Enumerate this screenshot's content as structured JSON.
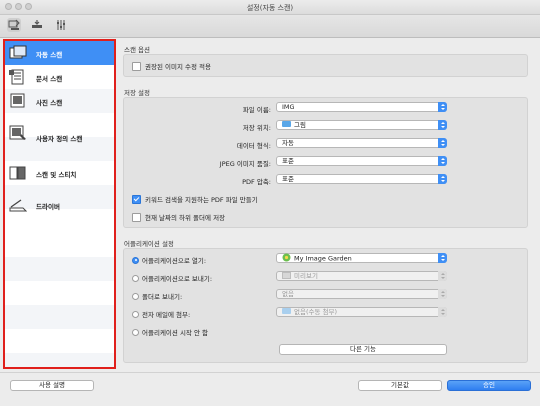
{
  "window": {
    "title": "설정(자동 스캔)"
  },
  "sidebar": {
    "items": [
      {
        "label": "자동 스캔",
        "icon": "auto-scan-icon"
      },
      {
        "label": "문서 스캔",
        "icon": "document-scan-icon"
      },
      {
        "label": "사진 스캔",
        "icon": "photo-scan-icon"
      },
      {
        "label": "사용자 정의 스캔",
        "icon": "custom-scan-icon"
      },
      {
        "label": "스캔 및 스티치",
        "icon": "scan-stitch-icon"
      },
      {
        "label": "드라이버",
        "icon": "driver-icon"
      }
    ]
  },
  "scan_options": {
    "title": "스캔 옵션",
    "apply_correction": "권장된 이미지 수정 적용"
  },
  "save_settings": {
    "title": "저장 설정",
    "file_name_label": "파일 이름:",
    "file_name_value": "IMG",
    "save_location_label": "저장 위치:",
    "save_location_value": "그림",
    "data_format_label": "데이터 형식:",
    "data_format_value": "자동",
    "jpeg_quality_label": "JPEG 이미지 품질:",
    "jpeg_quality_value": "표준",
    "pdf_compression_label": "PDF 압축:",
    "pdf_compression_value": "표준",
    "keyword_pdf": "키워드 검색을 지원하는 PDF 파일 만들기",
    "date_subfolder": "현재 날짜의 하위 폴더에 저장"
  },
  "app_settings": {
    "title": "어플리케이션 설정",
    "open_with_label": "어플리케이션으로 열기:",
    "open_with_value": "My Image Garden",
    "send_app_label": "어플리케이션으로 보내기:",
    "send_app_value": "미리보기",
    "send_folder_label": "폴더로 보내기:",
    "send_folder_value": "없음",
    "email_label": "전자 메일에 첨부:",
    "email_value": "없음(수동 첨부)",
    "no_app_label": "어플리케이션 시작 안 함",
    "more_functions": "다른 기능"
  },
  "footer": {
    "instructions": "사용 설명",
    "defaults": "기본값",
    "ok": "승인"
  },
  "colors": {
    "accent": "#3f8ff5",
    "highlight_border": "#e0201c"
  }
}
